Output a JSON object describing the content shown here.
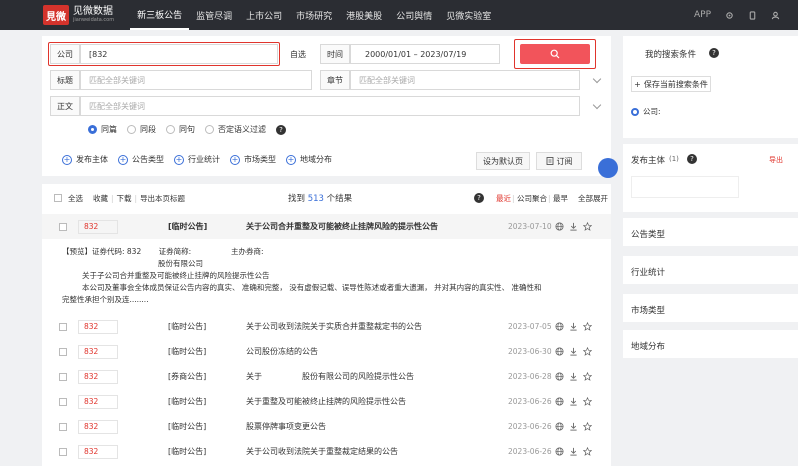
{
  "header": {
    "logo_mark": "見微",
    "logo_cn": "见微数据",
    "logo_en": "jianweidata.com",
    "nav": [
      "新三板公告",
      "监管尽调",
      "上市公司",
      "市场研究",
      "港股美股",
      "公司舆情",
      "见微实验室"
    ],
    "active_nav": 0,
    "app_label": "APP"
  },
  "search": {
    "company_label": "公司",
    "company_value": "[832",
    "self_select": "自选",
    "time_label": "时间",
    "time_value": "2000/01/01 – 2023/07/19",
    "title_label": "标题",
    "title_placeholder": "匹配全部关键词",
    "chapter_label": "章节",
    "chapter_placeholder": "匹配全部关键词",
    "body_label": "正文",
    "body_placeholder": "匹配全部关键词",
    "options": [
      "同篇",
      "同段",
      "同句",
      "否定语义过滤"
    ],
    "selected_option": 0,
    "filters": [
      "发布主体",
      "公告类型",
      "行业统计",
      "市场类型",
      "地域分布"
    ],
    "default_btn": "设为默认页",
    "subscribe_btn": "订阅"
  },
  "results_head": {
    "select_all": "全选",
    "collect": "收藏",
    "download": "下载",
    "export": "导出本页标题",
    "found_prefix": "找到",
    "count": "513",
    "found_suffix": "个结果",
    "sort": [
      "最近",
      "公司聚合",
      "最早"
    ],
    "expand_all": "全部展开"
  },
  "results": [
    {
      "code": "832",
      "tag": "[临时公告]",
      "title": "关于公司合并重整及可能被终止挂牌风险的提示性公告",
      "date": "2023-07-10",
      "highlight": true
    },
    {
      "code": "832",
      "tag": "[临时公告]",
      "title": "关于公司收到法院关于实质合并重整裁定书的公告",
      "date": "2023-07-05"
    },
    {
      "code": "832",
      "tag": "[临时公告]",
      "title": "公司股份冻结的公告",
      "date": "2023-06-30"
    },
    {
      "code": "832",
      "tag": "[券商公告]",
      "title": "关于　　　　　股份有限公司的风险提示性公告",
      "date": "2023-06-28"
    },
    {
      "code": "832",
      "tag": "[临时公告]",
      "title": "关于重整及可能被终止挂牌的风险提示性公告",
      "date": "2023-06-26"
    },
    {
      "code": "832",
      "tag": "[临时公告]",
      "title": "股票停牌事项变更公告",
      "date": "2023-06-26"
    },
    {
      "code": "832",
      "tag": "[临时公告]",
      "title": "关于公司收到法院关于重整裁定结果的公告",
      "date": "2023-06-26"
    }
  ],
  "preview": {
    "label": "【预览】",
    "line1": "证券代码:  832　　 证券简称:　　　　　 主办券商:",
    "line2": "股份有限公司",
    "line3": "关于子公司合并重整及可能被终止挂牌的风险提示性公告",
    "line4": "本公司及董事会全体成员保证公告内容的真实、 准确和完整， 没有虚假记载、误导性陈述或者重大遗漏， 并对其内容的真实性、 准确性和",
    "line5": "完整性承担个别及连........"
  },
  "right": {
    "my_conditions": "我的搜索条件",
    "save_btn": "保存当前搜索条件",
    "company_cond": "公司:",
    "publisher": "发布主体",
    "publisher_count": "(1)",
    "export_link": "导出",
    "sections": [
      "公告类型",
      "行业统计",
      "市场类型",
      "地域分布"
    ]
  },
  "colors": {
    "accent": "#e0342c",
    "blue": "#3a6fd8",
    "button": "#f2545b",
    "count": "#3a6fd8"
  }
}
